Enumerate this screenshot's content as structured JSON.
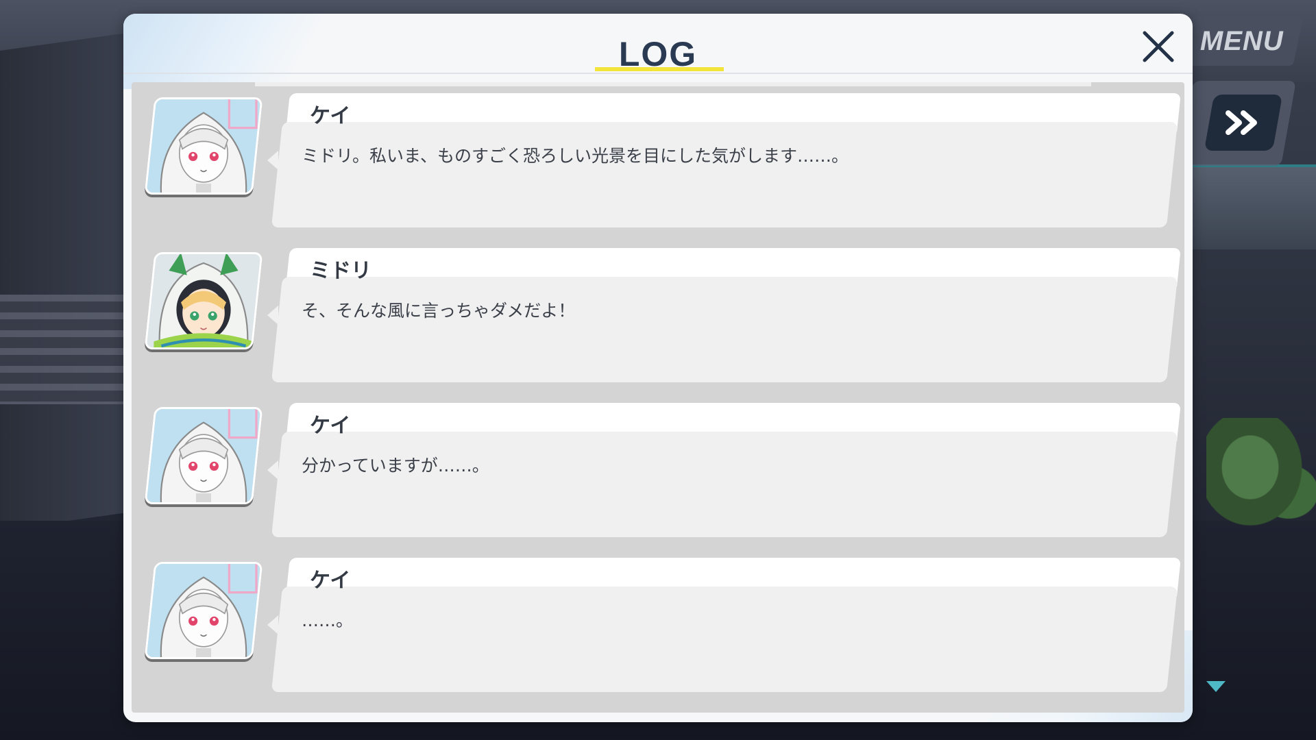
{
  "header": {
    "title": "LOG"
  },
  "hud": {
    "menu_label": "MENU"
  },
  "log": [
    {
      "speaker": "ケイ",
      "text": "ミドリ。私いま、ものすごく恐ろしい光景を目にした気がします……。",
      "avatar": "kei-portrait"
    },
    {
      "speaker": "ミドリ",
      "text": "そ、そんな風に言っちゃダメだよ！",
      "avatar": "midori-portrait"
    },
    {
      "speaker": "ケイ",
      "text": "分かっていますが……。",
      "avatar": "kei-portrait"
    },
    {
      "speaker": "ケイ",
      "text": "……。",
      "avatar": "kei-portrait"
    }
  ],
  "colors": {
    "title": "#2a3a52",
    "underline": "#f2e43a",
    "panel": "#f5f7f9",
    "list_bg": "#d4d4d4",
    "bubble_body": "#f0f0f0",
    "bubble_name": "#ffffff",
    "accent_cyan": "#4fb8c6"
  }
}
